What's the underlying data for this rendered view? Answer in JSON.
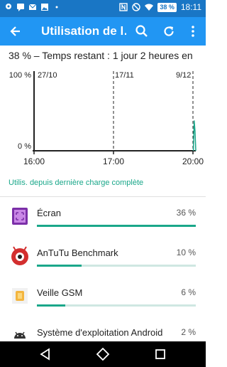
{
  "status_bar": {
    "left_icons": [
      "maps-pin-icon",
      "sms-icon",
      "mail-icon",
      "image-icon",
      "dots-icon"
    ],
    "right_icons": [
      "nfc-icon",
      "do-not-disturb-icon",
      "wifi-icon",
      "battery-icon"
    ],
    "battery": "38 %",
    "time": "18:11"
  },
  "app_bar": {
    "title": "Utilisation de l…",
    "icons": [
      "back-arrow-icon",
      "search-icon",
      "refresh-icon",
      "more-vert-icon"
    ]
  },
  "summary": {
    "remaining": "38 % – Temps restant : 1 jour 2 heures en"
  },
  "chart_data": {
    "type": "line",
    "title": "",
    "xlabel": "",
    "ylabel": "",
    "ylim": [
      0,
      100
    ],
    "y_tick_labels": [
      "100 %",
      "0 %"
    ],
    "x_tick_labels": [
      "16:00",
      "17:00",
      "20:00"
    ],
    "date_markers": [
      "27/10",
      "17/11",
      "9/12"
    ],
    "series": [
      {
        "color": "#1aa78a",
        "x": [
          0.985,
          0.99,
          0.995,
          1.0
        ],
        "values": [
          0,
          38,
          25,
          0
        ]
      }
    ],
    "grid": false
  },
  "section": {
    "since_label": "Utilis. depuis dernière charge complète"
  },
  "apps": [
    {
      "name": "Écran",
      "percent_label": "36 %",
      "fraction": 1.0,
      "icon": "screen-icon"
    },
    {
      "name": "AnTuTu Benchmark",
      "percent_label": "10 %",
      "fraction": 0.28,
      "icon": "antutu-icon"
    },
    {
      "name": "Veille GSM",
      "percent_label": "6 %",
      "fraction": 0.18,
      "icon": "sim-card-icon"
    },
    {
      "name": "Système d'exploitation Android",
      "percent_label": "2 %",
      "fraction": 0.05,
      "icon": "android-icon"
    }
  ],
  "colors": {
    "status_bar": "#1976c5",
    "app_bar": "#2196f3",
    "accent": "#1aa78a"
  }
}
